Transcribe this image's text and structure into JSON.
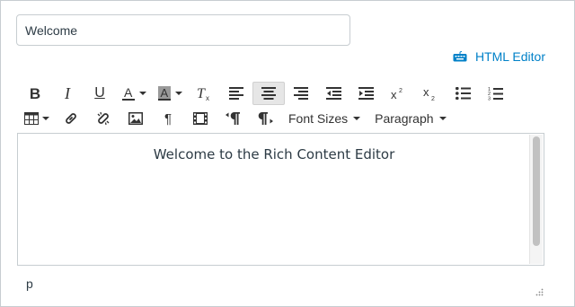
{
  "title_field": {
    "value": "Welcome"
  },
  "html_editor_link": {
    "label": "HTML Editor",
    "color": "#0081c8"
  },
  "toolbar": {
    "row1": [
      {
        "name": "bold-button",
        "icon": "bold-icon"
      },
      {
        "name": "italic-button",
        "icon": "italic-icon"
      },
      {
        "name": "underline-button",
        "icon": "underline-icon"
      },
      {
        "name": "text-color-button",
        "icon": "text-color-icon"
      },
      {
        "name": "background-color-button",
        "icon": "background-color-icon"
      },
      {
        "name": "clear-formatting-button",
        "icon": "clear-formatting-icon"
      },
      {
        "name": "align-left-button",
        "icon": "align-left-icon"
      },
      {
        "name": "align-center-button",
        "icon": "align-center-icon",
        "active": true
      },
      {
        "name": "align-right-button",
        "icon": "align-right-icon"
      },
      {
        "name": "outdent-button",
        "icon": "outdent-icon"
      },
      {
        "name": "indent-button",
        "icon": "indent-icon"
      },
      {
        "name": "superscript-button",
        "icon": "superscript-icon"
      },
      {
        "name": "subscript-button",
        "icon": "subscript-icon"
      },
      {
        "name": "bullet-list-button",
        "icon": "bullet-list-icon"
      },
      {
        "name": "numbered-list-button",
        "icon": "numbered-list-icon"
      }
    ],
    "row2": [
      {
        "name": "table-button",
        "icon": "table-icon"
      },
      {
        "name": "insert-link-button",
        "icon": "link-icon"
      },
      {
        "name": "remove-link-button",
        "icon": "unlink-icon"
      },
      {
        "name": "insert-image-button",
        "icon": "image-icon"
      },
      {
        "name": "paragraph-mark-button",
        "icon": "pilcrow-icon"
      },
      {
        "name": "insert-media-button",
        "icon": "film-icon"
      },
      {
        "name": "rtl-paragraph-button",
        "icon": "rtl-pilcrow-icon"
      },
      {
        "name": "ltr-paragraph-button",
        "icon": "ltr-pilcrow-icon"
      }
    ],
    "font_sizes_label": "Font Sizes",
    "paragraph_label": "Paragraph"
  },
  "editor": {
    "content": "Welcome to the Rich Content Editor",
    "status_path": "p"
  }
}
